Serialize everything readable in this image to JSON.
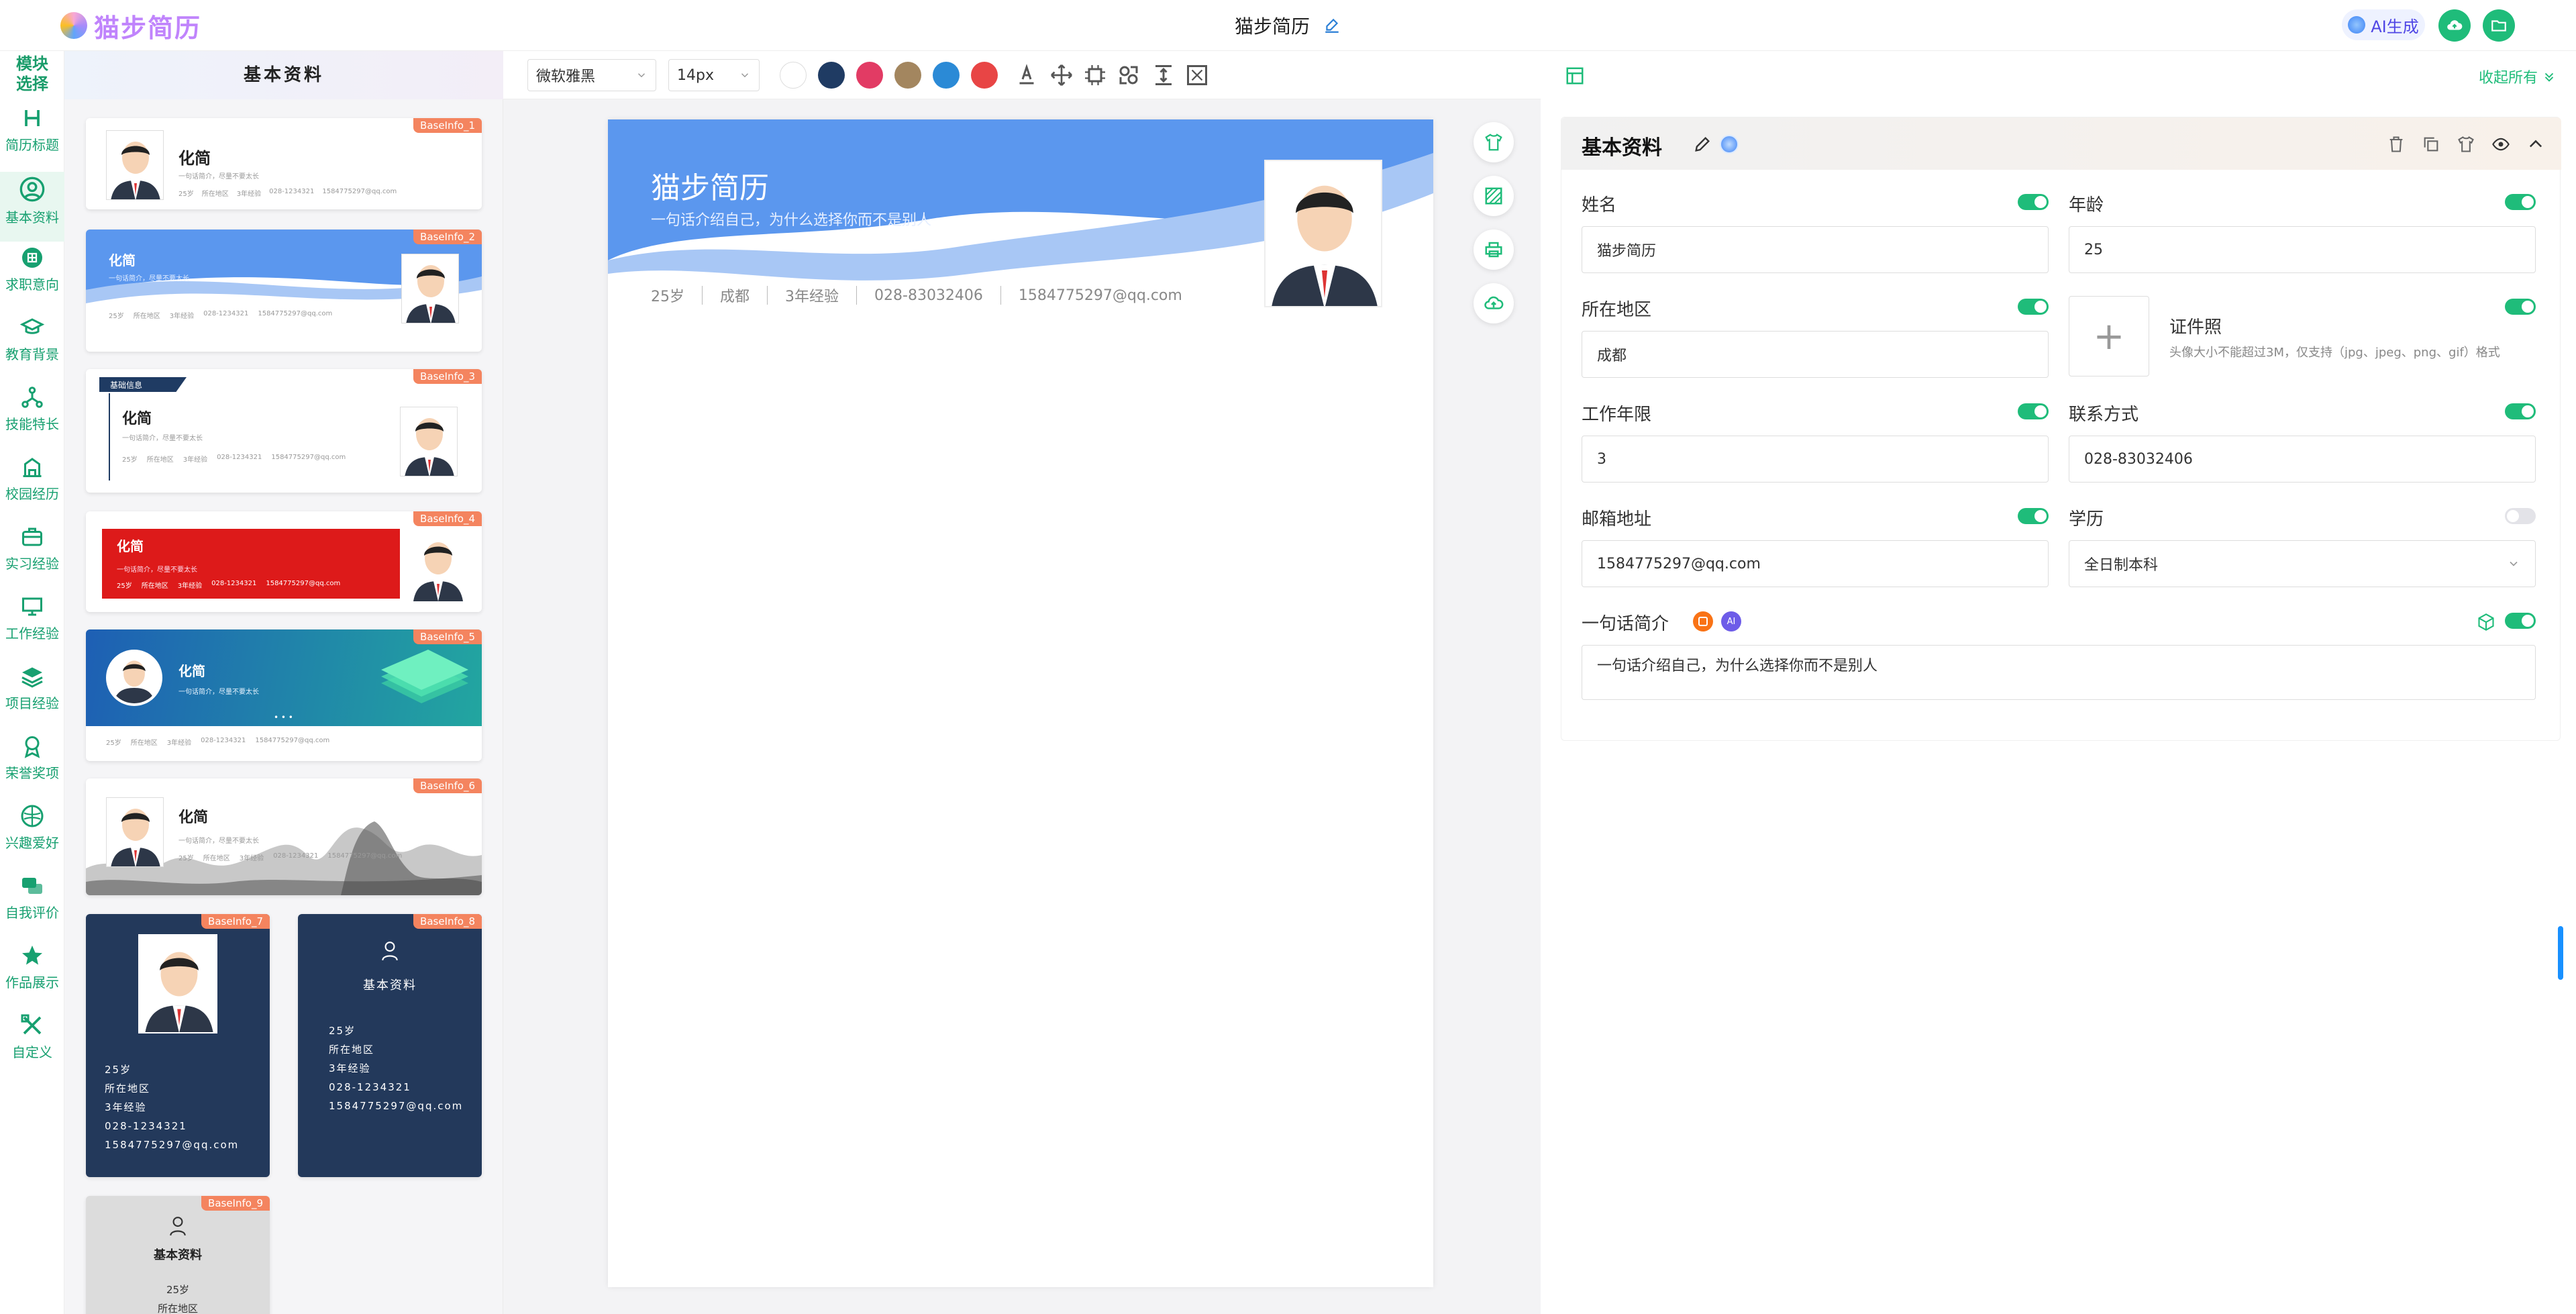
{
  "app": {
    "logo_text": "猫步简历",
    "doc_title": "猫步简历",
    "ai_label": "AI生成"
  },
  "module_nav": {
    "header": "模块选择",
    "items": [
      {
        "label": "简历标题",
        "icon": "heading-icon"
      },
      {
        "label": "基本资料",
        "icon": "user-icon"
      },
      {
        "label": "求职意向",
        "icon": "target-icon"
      },
      {
        "label": "教育背景",
        "icon": "graduation-icon"
      },
      {
        "label": "技能特长",
        "icon": "skill-icon"
      },
      {
        "label": "校园经历",
        "icon": "campus-icon"
      },
      {
        "label": "实习经验",
        "icon": "briefcase-icon"
      },
      {
        "label": "工作经验",
        "icon": "monitor-icon"
      },
      {
        "label": "项目经验",
        "icon": "layers-icon"
      },
      {
        "label": "荣誉奖项",
        "icon": "award-icon"
      },
      {
        "label": "兴趣爱好",
        "icon": "hobby-icon"
      },
      {
        "label": "自我评价",
        "icon": "chat-icon"
      },
      {
        "label": "作品展示",
        "icon": "star-icon"
      },
      {
        "label": "自定义",
        "icon": "tools-icon"
      }
    ]
  },
  "templates": {
    "title": "基本资料",
    "mini": {
      "name": "化简",
      "intro": "一句话简介，尽量不要太长",
      "age": "25岁",
      "region": "所在地区",
      "exp": "3年经验",
      "phone": "028-1234321",
      "email": "1584775297@qq.com",
      "section_label": "基础信息",
      "panel_title": "基本资料",
      "dots": "• • •"
    },
    "badges": [
      "BaseInfo_1",
      "BaseInfo_2",
      "BaseInfo_3",
      "BaseInfo_4",
      "BaseInfo_5",
      "BaseInfo_6",
      "BaseInfo_7",
      "BaseInfo_8",
      "BaseInfo_9"
    ]
  },
  "toolbar": {
    "font": "微软雅黑",
    "size": "14px",
    "colors": [
      "#ffffff",
      "#1f3b63",
      "#e23b64",
      "#a3865f",
      "#2b8ad6",
      "#e84545"
    ]
  },
  "resume": {
    "name": "猫步简历",
    "intro": "一句话介绍自己，为什么选择你而不是别人",
    "age": "25岁",
    "city": "成都",
    "exp": "3年经验",
    "phone": "028-83032406",
    "email": "1584775297@qq.com",
    "accent": "#4a90e2"
  },
  "form": {
    "collapse_label": "收起所有",
    "section_title": "基本资料",
    "name_label": "姓名",
    "name_value": "猫步简历",
    "age_label": "年龄",
    "age_value": "25",
    "region_label": "所在地区",
    "region_value": "成都",
    "photo_label": "证件照",
    "photo_hint": "头像大小不能超过3M，仅支持（jpg、jpeg、png、gif）格式",
    "years_label": "工作年限",
    "years_value": "3",
    "contact_label": "联系方式",
    "contact_value": "028-83032406",
    "email_label": "邮箱地址",
    "email_value": "1584775297@qq.com",
    "edu_label": "学历",
    "edu_value": "全日制本科",
    "intro_label": "一句话简介",
    "intro_value": "一句话介绍自己，为什么选择你而不是别人",
    "ai_badge": "AI",
    "plus": "+"
  }
}
